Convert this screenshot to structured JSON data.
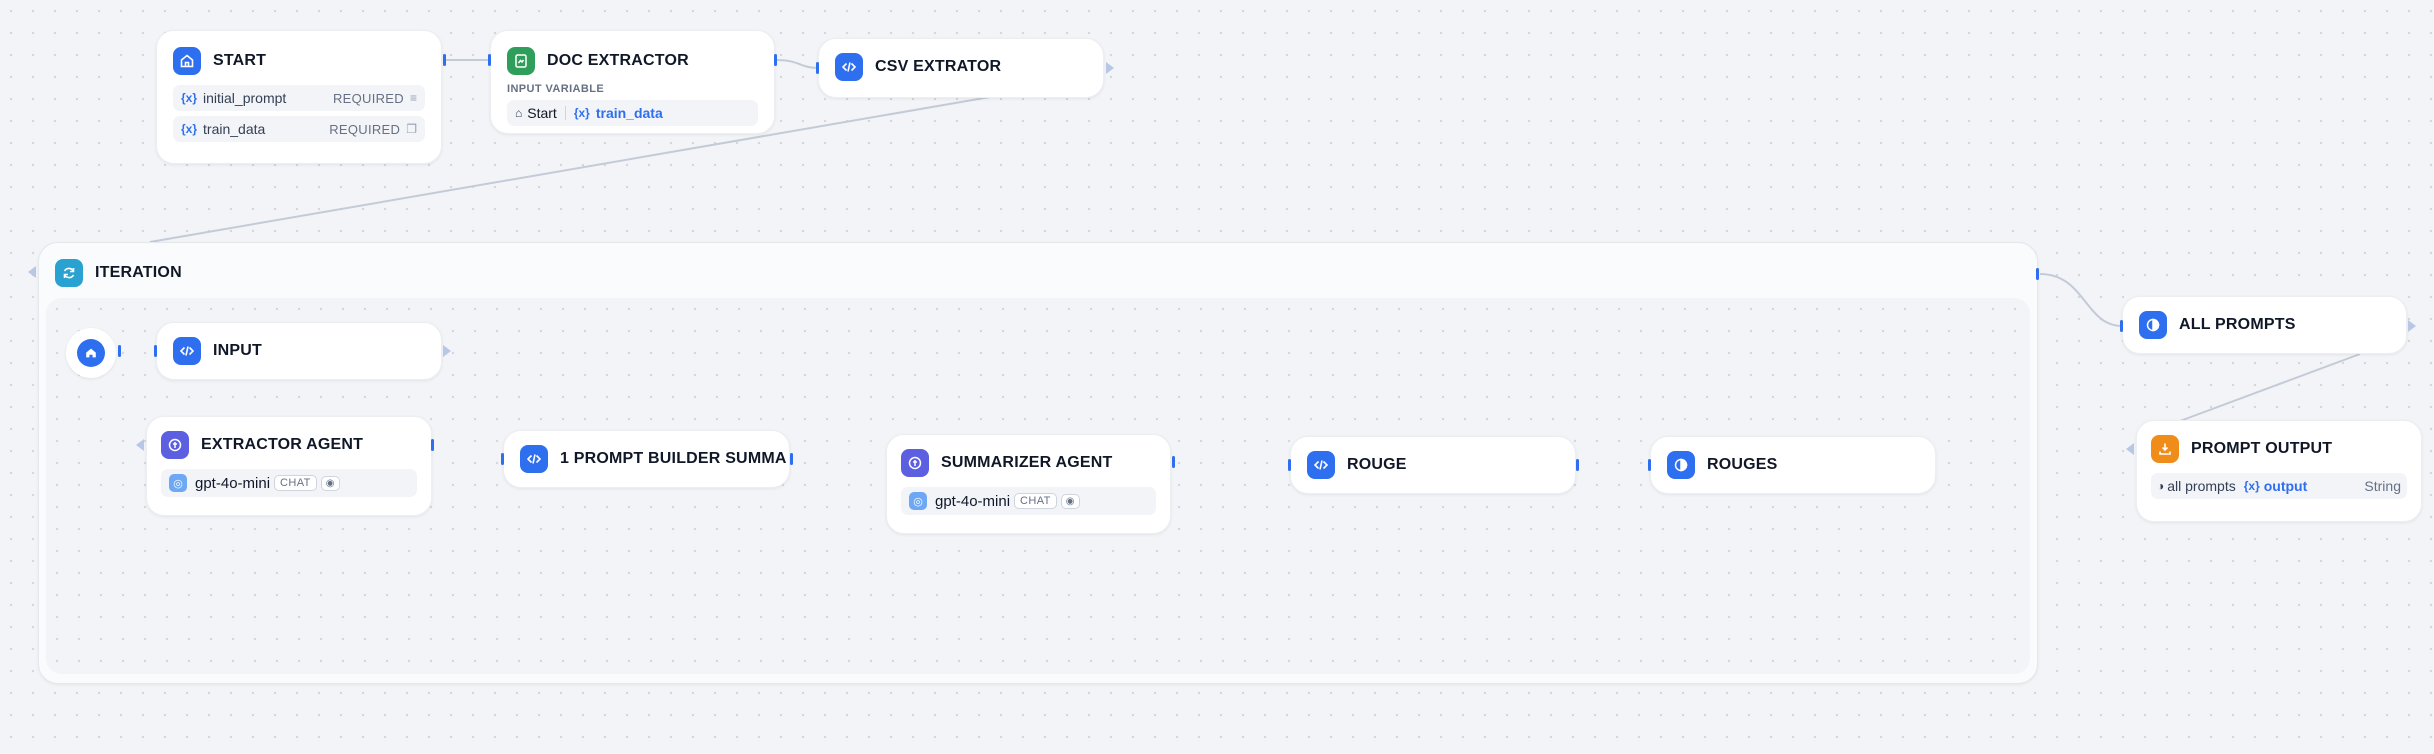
{
  "nodes": {
    "start": {
      "title": "START",
      "variables": [
        {
          "name": "initial_prompt",
          "status": "REQUIRED"
        },
        {
          "name": "train_data",
          "status": "REQUIRED"
        }
      ]
    },
    "doc_extractor": {
      "title": "DOC EXTRACTOR",
      "section_label": "INPUT VARIABLE",
      "source_node": "Start",
      "source_var": "train_data"
    },
    "csv_extractor": {
      "title": "CSV EXTRATOR"
    },
    "iteration": {
      "title": "ITERATION"
    },
    "input": {
      "title": "INPUT"
    },
    "extractor_agent": {
      "title": "EXTRACTOR AGENT",
      "model": "gpt-4o-mini",
      "mode": "CHAT"
    },
    "prompt_builder": {
      "title": "1 PROMPT BUILDER SUMMA"
    },
    "summarizer_agent": {
      "title": "SUMMARIZER AGENT",
      "model": "gpt-4o-mini",
      "mode": "CHAT"
    },
    "rouge": {
      "title": "ROUGE"
    },
    "rouges": {
      "title": "ROUGES"
    },
    "all_prompts": {
      "title": "ALL PROMPTS"
    },
    "prompt_output": {
      "title": "PROMPT OUTPUT",
      "source": "all prompts",
      "var": "output",
      "type": "String"
    }
  },
  "colors": {
    "accent": "#2e6ff0",
    "code_node": "#2e6ff0",
    "agent_node": "#5b5fe0",
    "doc_node": "#2f9e5a",
    "iteration_node": "#2aa2d1",
    "output_node": "#f08c1a",
    "edge": "#c4cbd8"
  },
  "icons": {
    "start": "home-icon",
    "doc_extractor": "document-icon",
    "code": "code-icon",
    "agent": "agent-icon",
    "iteration": "loop-icon",
    "aggregator": "aggregator-icon",
    "output": "output-icon",
    "model": "openai-icon",
    "visibility": "eye-icon"
  }
}
